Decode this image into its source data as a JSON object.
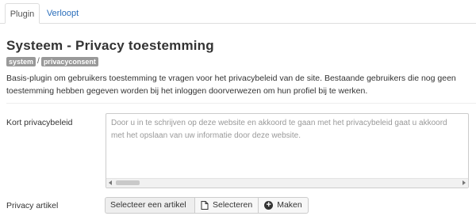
{
  "tabs": [
    {
      "label": "Plugin",
      "active": true
    },
    {
      "label": "Verloopt",
      "active": false
    }
  ],
  "header": {
    "title": "Systeem - Privacy toestemming",
    "tags": [
      "system",
      "privacyconsent"
    ],
    "tag_separator": "/"
  },
  "description": "Basis-plugin om gebruikers toestemming te vragen voor het privacybeleid van de site. Bestaande gebruikers die nog geen toestemming hebben gegeven worden bij het inloggen doorverwezen om hun profiel bij te werken.",
  "fields": {
    "short_policy": {
      "label": "Kort privacybeleid",
      "placeholder": "Door u in te schrijven op deze website en akkoord te gaan met het privacybeleid gaat u akkoord met het opslaan van uw informatie door deze website.",
      "value": ""
    },
    "privacy_article": {
      "label": "Privacy artikel",
      "selected": "Selecteer een artikel",
      "select_button": "Selecteren",
      "make_button": "Maken"
    }
  },
  "colors": {
    "link": "#2a6ebb",
    "tag_bg": "#999999",
    "placeholder": "#999999"
  },
  "icons": {
    "select_button_icon": "file-icon",
    "make_button_icon": "plus-circle-icon"
  }
}
